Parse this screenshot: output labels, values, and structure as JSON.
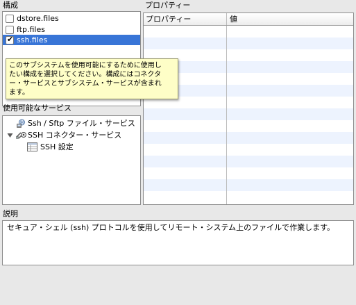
{
  "configurations": {
    "label": "構成",
    "items": [
      {
        "name": "dstore.files",
        "checked": false,
        "selected": false
      },
      {
        "name": "ftp.files",
        "checked": false,
        "selected": false
      },
      {
        "name": "ssh.files",
        "checked": true,
        "selected": true
      }
    ],
    "tooltip": "このサブシステムを使用可能にするために使用し\nたい構成を選択してください。構成にはコネクタ\nー・サービスとサブシステム・サービスが含まれ\nます。"
  },
  "services": {
    "label": "使用可能なサービス",
    "tree": [
      {
        "label": "Ssh / Sftp ファイル・サービス",
        "icon": "file-service-icon",
        "level": 1
      },
      {
        "label": "SSH コネクター・サービス",
        "icon": "connector-service-icon",
        "level": 0,
        "expanded": true
      },
      {
        "label": "SSH 設定",
        "icon": "properties-table-icon",
        "level": 2
      }
    ]
  },
  "properties": {
    "label": "プロパティー",
    "columns": [
      "プロパティー",
      "値"
    ],
    "rows": []
  },
  "description": {
    "label": "説明",
    "text": "セキュア・シェル (ssh) プロトコルを使用してリモート・システム上のファイルで作業します。"
  },
  "colors": {
    "selection": "#3875d7",
    "tooltip_bg": "#fefec7",
    "stripe": "#edf3fe",
    "window_bg": "#e8e8e8"
  }
}
